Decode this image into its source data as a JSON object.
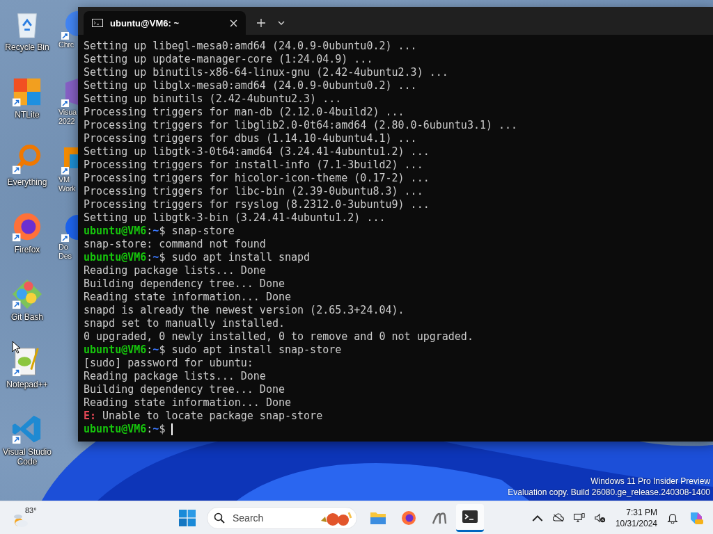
{
  "desktop_icons": [
    {
      "kind": "recycle",
      "label": "Recycle Bin",
      "shortcut": false
    },
    {
      "kind": "ntlite",
      "label": "NTLite",
      "shortcut": true
    },
    {
      "kind": "everything",
      "label": "Everything",
      "shortcut": true
    },
    {
      "kind": "firefox",
      "label": "Firefox",
      "shortcut": true
    },
    {
      "kind": "gitbash",
      "label": "Git Bash",
      "shortcut": true
    },
    {
      "kind": "notepad",
      "label": "Notepad++",
      "shortcut": true
    },
    {
      "kind": "vscode",
      "label": "Visual Studio Code",
      "shortcut": true
    }
  ],
  "desktop_icons_partial": [
    {
      "kind": "chrome",
      "label": "Chrc"
    },
    {
      "kind": "vstudio",
      "label": "Visua 2022"
    },
    {
      "kind": "vmware",
      "label": "VM Work"
    },
    {
      "kind": "docker",
      "label": "Do Des"
    }
  ],
  "terminal": {
    "tab": {
      "title": "ubuntu@VM6: ~",
      "selected": true
    },
    "lines": [
      {
        "segments": [
          {
            "kind": "plain",
            "text": "Setting up libegl-mesa0:amd64 (24.0.9-0ubuntu0.2) ..."
          }
        ]
      },
      {
        "segments": [
          {
            "kind": "plain",
            "text": "Setting up update-manager-core (1:24.04.9) ..."
          }
        ]
      },
      {
        "segments": [
          {
            "kind": "plain",
            "text": "Setting up binutils-x86-64-linux-gnu (2.42-4ubuntu2.3) ..."
          }
        ]
      },
      {
        "segments": [
          {
            "kind": "plain",
            "text": "Setting up libglx-mesa0:amd64 (24.0.9-0ubuntu0.2) ..."
          }
        ]
      },
      {
        "segments": [
          {
            "kind": "plain",
            "text": "Setting up binutils (2.42-4ubuntu2.3) ..."
          }
        ]
      },
      {
        "segments": [
          {
            "kind": "plain",
            "text": "Processing triggers for man-db (2.12.0-4build2) ..."
          }
        ]
      },
      {
        "segments": [
          {
            "kind": "plain",
            "text": "Processing triggers for libglib2.0-0t64:amd64 (2.80.0-6ubuntu3.1) ..."
          }
        ]
      },
      {
        "segments": [
          {
            "kind": "plain",
            "text": "Processing triggers for dbus (1.14.10-4ubuntu4.1) ..."
          }
        ]
      },
      {
        "segments": [
          {
            "kind": "plain",
            "text": "Setting up libgtk-3-0t64:amd64 (3.24.41-4ubuntu1.2) ..."
          }
        ]
      },
      {
        "segments": [
          {
            "kind": "plain",
            "text": "Processing triggers for install-info (7.1-3build2) ..."
          }
        ]
      },
      {
        "segments": [
          {
            "kind": "plain",
            "text": "Processing triggers for hicolor-icon-theme (0.17-2) ..."
          }
        ]
      },
      {
        "segments": [
          {
            "kind": "plain",
            "text": "Processing triggers for libc-bin (2.39-0ubuntu8.3) ..."
          }
        ]
      },
      {
        "segments": [
          {
            "kind": "plain",
            "text": "Processing triggers for rsyslog (8.2312.0-3ubuntu9) ..."
          }
        ]
      },
      {
        "segments": [
          {
            "kind": "plain",
            "text": "Setting up libgtk-3-bin (3.24.41-4ubuntu1.2) ..."
          }
        ]
      },
      {
        "segments": [
          {
            "kind": "user",
            "text": "ubuntu@VM6"
          },
          {
            "kind": "plain",
            "text": ":"
          },
          {
            "kind": "path",
            "text": "~"
          },
          {
            "kind": "plain",
            "text": "$ snap-store"
          }
        ]
      },
      {
        "segments": [
          {
            "kind": "plain",
            "text": "snap-store: command not found"
          }
        ]
      },
      {
        "segments": [
          {
            "kind": "user",
            "text": "ubuntu@VM6"
          },
          {
            "kind": "plain",
            "text": ":"
          },
          {
            "kind": "path",
            "text": "~"
          },
          {
            "kind": "plain",
            "text": "$ sudo apt install snapd"
          }
        ]
      },
      {
        "segments": [
          {
            "kind": "plain",
            "text": "Reading package lists... Done"
          }
        ]
      },
      {
        "segments": [
          {
            "kind": "plain",
            "text": "Building dependency tree... Done"
          }
        ]
      },
      {
        "segments": [
          {
            "kind": "plain",
            "text": "Reading state information... Done"
          }
        ]
      },
      {
        "segments": [
          {
            "kind": "plain",
            "text": "snapd is already the newest version (2.65.3+24.04)."
          }
        ]
      },
      {
        "segments": [
          {
            "kind": "plain",
            "text": "snapd set to manually installed."
          }
        ]
      },
      {
        "segments": [
          {
            "kind": "plain",
            "text": "0 upgraded, 0 newly installed, 0 to remove and 0 not upgraded."
          }
        ]
      },
      {
        "segments": [
          {
            "kind": "user",
            "text": "ubuntu@VM6"
          },
          {
            "kind": "plain",
            "text": ":"
          },
          {
            "kind": "path",
            "text": "~"
          },
          {
            "kind": "plain",
            "text": "$ sudo apt install snap-store"
          }
        ]
      },
      {
        "segments": [
          {
            "kind": "plain",
            "text": "[sudo] password for ubuntu:"
          }
        ]
      },
      {
        "segments": [
          {
            "kind": "plain",
            "text": "Reading package lists... Done"
          }
        ]
      },
      {
        "segments": [
          {
            "kind": "plain",
            "text": "Building dependency tree... Done"
          }
        ]
      },
      {
        "segments": [
          {
            "kind": "plain",
            "text": "Reading state information... Done"
          }
        ]
      },
      {
        "segments": [
          {
            "kind": "error",
            "text": "E:"
          },
          {
            "kind": "plain",
            "text": " Unable to locate package snap-store"
          }
        ]
      },
      {
        "cursor": true,
        "segments": [
          {
            "kind": "user",
            "text": "ubuntu@VM6"
          },
          {
            "kind": "plain",
            "text": ":"
          },
          {
            "kind": "path",
            "text": "~"
          },
          {
            "kind": "plain",
            "text": "$ "
          }
        ]
      }
    ]
  },
  "desktop_notice": [
    "Windows 11 Pro Insider Preview",
    "Evaluation copy. Build 26080.ge_release.240308-1400"
  ],
  "taskbar": {
    "weather": {
      "temperature": "83°"
    },
    "search": {
      "placeholder": "Search"
    },
    "apps": [
      {
        "kind": "explorer",
        "selected": false
      },
      {
        "kind": "firefox",
        "selected": false
      },
      {
        "kind": "notepad",
        "selected": false
      },
      {
        "kind": "terminal",
        "selected": true
      }
    ],
    "clock": {
      "time": "7:31 PM",
      "date": "10/31/2024"
    }
  }
}
